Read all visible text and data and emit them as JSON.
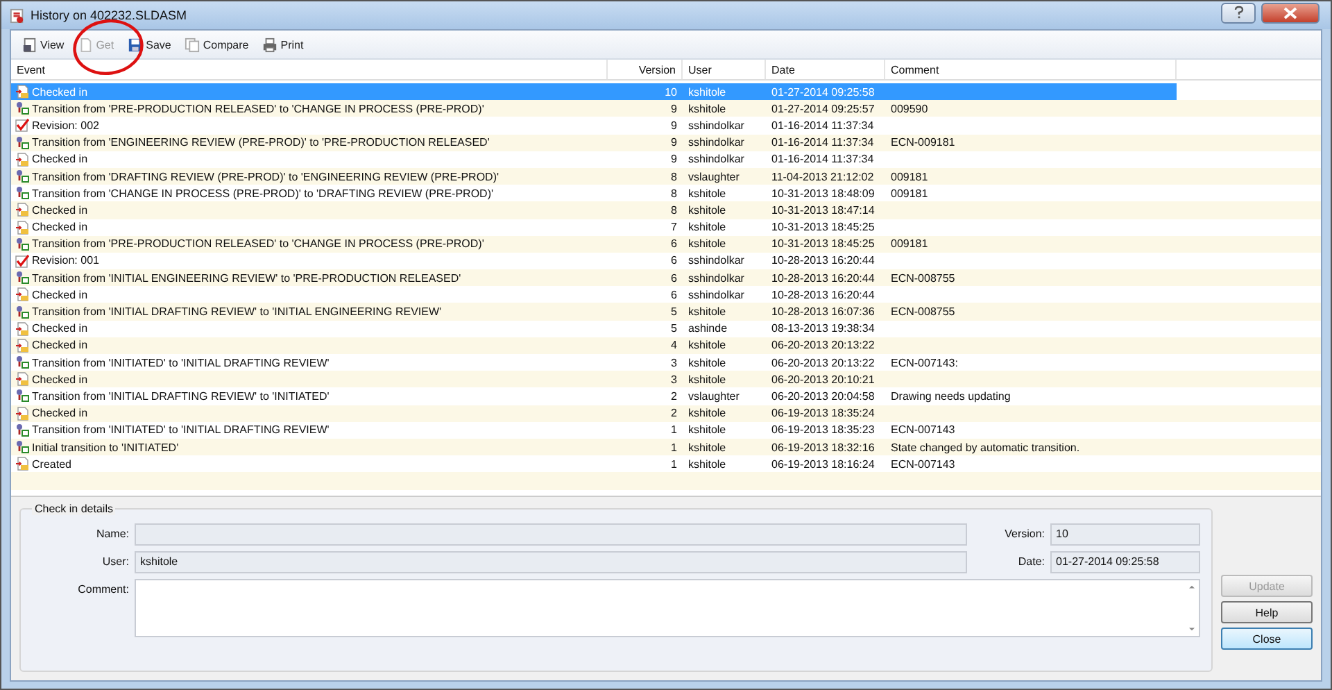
{
  "window": {
    "title": "History on 402232.SLDASM"
  },
  "toolbar": [
    {
      "label": "View",
      "kind": "view",
      "disabled": false
    },
    {
      "label": "Get",
      "kind": "get",
      "disabled": true
    },
    {
      "label": "Save",
      "kind": "save",
      "disabled": false
    },
    {
      "label": "Compare",
      "kind": "compare",
      "disabled": false
    },
    {
      "label": "Print",
      "kind": "print",
      "disabled": false
    }
  ],
  "table": {
    "columns": [
      "Event",
      "Version",
      "User",
      "Date",
      "Comment"
    ],
    "rows": [
      {
        "kind": "checkin",
        "event": "Checked in",
        "version": "10",
        "user": "kshitole",
        "date": "01-27-2014 09:25:58",
        "comment": "",
        "selected": true
      },
      {
        "kind": "transition",
        "event": "Transition from 'PRE-PRODUCTION RELEASED' to 'CHANGE IN PROCESS (PRE-PROD)'",
        "version": "9",
        "user": "kshitole",
        "date": "01-27-2014 09:25:57",
        "comment": "009590",
        "selected": false
      },
      {
        "kind": "revision",
        "event": "Revision: 002",
        "version": "9",
        "user": "sshindolkar",
        "date": "01-16-2014 11:37:34",
        "comment": "",
        "selected": false
      },
      {
        "kind": "transition",
        "event": "Transition from 'ENGINEERING REVIEW (PRE-PROD)' to 'PRE-PRODUCTION RELEASED'",
        "version": "9",
        "user": "sshindolkar",
        "date": "01-16-2014 11:37:34",
        "comment": "ECN-009181",
        "selected": false
      },
      {
        "kind": "checkin",
        "event": "Checked in",
        "version": "9",
        "user": "sshindolkar",
        "date": "01-16-2014 11:37:34",
        "comment": "",
        "selected": false
      },
      {
        "kind": "transition",
        "event": "Transition from 'DRAFTING REVIEW (PRE-PROD)' to 'ENGINEERING REVIEW (PRE-PROD)'",
        "version": "8",
        "user": "vslaughter",
        "date": "11-04-2013 21:12:02",
        "comment": "009181",
        "selected": false
      },
      {
        "kind": "transition",
        "event": "Transition from 'CHANGE IN PROCESS (PRE-PROD)' to 'DRAFTING REVIEW (PRE-PROD)'",
        "version": "8",
        "user": "kshitole",
        "date": "10-31-2013 18:48:09",
        "comment": "009181",
        "selected": false
      },
      {
        "kind": "checkin",
        "event": "Checked in",
        "version": "8",
        "user": "kshitole",
        "date": "10-31-2013 18:47:14",
        "comment": "",
        "selected": false
      },
      {
        "kind": "checkin",
        "event": "Checked in",
        "version": "7",
        "user": "kshitole",
        "date": "10-31-2013 18:45:25",
        "comment": "",
        "selected": false
      },
      {
        "kind": "transition",
        "event": "Transition from 'PRE-PRODUCTION RELEASED' to 'CHANGE IN PROCESS (PRE-PROD)'",
        "version": "6",
        "user": "kshitole",
        "date": "10-31-2013 18:45:25",
        "comment": "009181",
        "selected": false
      },
      {
        "kind": "revision",
        "event": "Revision: 001",
        "version": "6",
        "user": "sshindolkar",
        "date": "10-28-2013 16:20:44",
        "comment": "",
        "selected": false
      },
      {
        "kind": "transition",
        "event": "Transition from 'INITIAL ENGINEERING REVIEW' to 'PRE-PRODUCTION RELEASED'",
        "version": "6",
        "user": "sshindolkar",
        "date": "10-28-2013 16:20:44",
        "comment": "ECN-008755",
        "selected": false
      },
      {
        "kind": "checkin",
        "event": "Checked in",
        "version": "6",
        "user": "sshindolkar",
        "date": "10-28-2013 16:20:44",
        "comment": "",
        "selected": false
      },
      {
        "kind": "transition",
        "event": "Transition from 'INITIAL DRAFTING REVIEW' to 'INITIAL ENGINEERING REVIEW'",
        "version": "5",
        "user": "kshitole",
        "date": "10-28-2013 16:07:36",
        "comment": "ECN-008755",
        "selected": false
      },
      {
        "kind": "checkin",
        "event": "Checked in",
        "version": "5",
        "user": "ashinde",
        "date": "08-13-2013 19:38:34",
        "comment": "",
        "selected": false
      },
      {
        "kind": "checkin",
        "event": "Checked in",
        "version": "4",
        "user": "kshitole",
        "date": "06-20-2013 20:13:22",
        "comment": "",
        "selected": false
      },
      {
        "kind": "transition",
        "event": "Transition from 'INITIATED' to 'INITIAL DRAFTING REVIEW'",
        "version": "3",
        "user": "kshitole",
        "date": "06-20-2013 20:13:22",
        "comment": "ECN-007143:",
        "selected": false
      },
      {
        "kind": "checkin",
        "event": "Checked in",
        "version": "3",
        "user": "kshitole",
        "date": "06-20-2013 20:10:21",
        "comment": "",
        "selected": false
      },
      {
        "kind": "transition",
        "event": "Transition from 'INITIAL DRAFTING REVIEW' to 'INITIATED'",
        "version": "2",
        "user": "vslaughter",
        "date": "06-20-2013 20:04:58",
        "comment": "Drawing needs updating",
        "selected": false
      },
      {
        "kind": "checkin",
        "event": "Checked in",
        "version": "2",
        "user": "kshitole",
        "date": "06-19-2013 18:35:24",
        "comment": "",
        "selected": false
      },
      {
        "kind": "transition",
        "event": "Transition from 'INITIATED' to 'INITIAL DRAFTING REVIEW'",
        "version": "1",
        "user": "kshitole",
        "date": "06-19-2013 18:35:23",
        "comment": "ECN-007143",
        "selected": false
      },
      {
        "kind": "transition",
        "event": "Initial transition to 'INITIATED'",
        "version": "1",
        "user": "kshitole",
        "date": "06-19-2013 18:32:16",
        "comment": "State changed by automatic transition.",
        "selected": false
      },
      {
        "kind": "checkin",
        "event": "Created",
        "version": "1",
        "user": "kshitole",
        "date": "06-19-2013 18:16:24",
        "comment": "ECN-007143",
        "selected": false
      }
    ]
  },
  "details": {
    "title": "Check in details",
    "name": {
      "label": "Name:"
    },
    "user": {
      "label": "User:",
      "value": "kshitole"
    },
    "comment": {
      "label": "Comment:"
    },
    "version": {
      "label": "Version:",
      "value": "10"
    },
    "date": {
      "label": "Date:",
      "value": "01-27-2014 09:25:58"
    }
  },
  "buttons": [
    {
      "label": "Update",
      "disabled": true
    },
    {
      "label": "Help",
      "disabled": false
    },
    {
      "label": "Close",
      "disabled": false
    }
  ]
}
